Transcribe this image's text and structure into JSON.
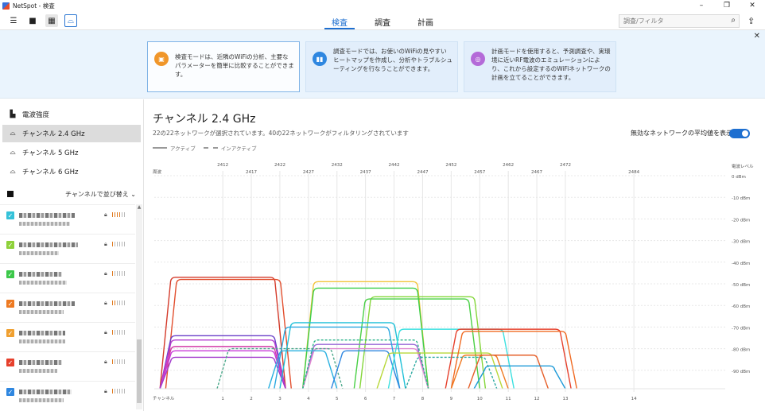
{
  "window": {
    "title": "NetSpot - 検査",
    "minimize": "–",
    "restore": "❐",
    "close": "✕"
  },
  "toolbar": {
    "tabs": [
      {
        "label": "検査",
        "active": true
      },
      {
        "label": "調査",
        "active": false
      },
      {
        "label": "計画",
        "active": false
      }
    ],
    "search_placeholder": "調査/フィルタ",
    "menu_icon": "☰",
    "stop_icon": "■",
    "grid_icon": "▦",
    "channel_icon": "⌓"
  },
  "banner": {
    "cards": [
      {
        "text": "検査モードは、近隣のWiFiの分析、主要なパラメーターを簡単に比較することができます。",
        "color": "#f0962a",
        "icon": "▣"
      },
      {
        "text": "調査モードでは、お使いのWiFiの見やすいヒートマップを作成し、分析やトラブルシューティングを行なうことができます。",
        "color": "#2f87e0",
        "icon": "▮▮"
      },
      {
        "text": "計画モードを使用すると、予測調査や、実環境に近いRF電波のエミュレーションにより、これから設定するのWiFiネットワークの計画を立てることができます。",
        "color": "#b46ad8",
        "icon": "◎"
      }
    ],
    "close": "✕"
  },
  "sidebar": {
    "items": [
      {
        "label": "電波強度",
        "icon": "▙",
        "active": false
      },
      {
        "label": "チャンネル 2.4 GHz",
        "icon": "⌓",
        "active": true
      },
      {
        "label": "チャンネル 5 GHz",
        "icon": "⌓",
        "active": false
      },
      {
        "label": "チャンネル 6 GHz",
        "icon": "⌓",
        "active": false
      }
    ],
    "sort_label": "チャンネルで並び替え ⌄",
    "networks": [
      {
        "checkbox_color": "#35c2d9",
        "signal": 0.6
      },
      {
        "checkbox_color": "#8ed13a",
        "signal": 0.2
      },
      {
        "checkbox_color": "#3cc84a",
        "signal": 0.2
      },
      {
        "checkbox_color": "#ee7a22",
        "signal": 0.4
      },
      {
        "checkbox_color": "#f0a030",
        "signal": 0.2
      },
      {
        "checkbox_color": "#e6402c",
        "signal": 0.2
      },
      {
        "checkbox_color": "#2f87e0",
        "signal": 0.2
      }
    ]
  },
  "main": {
    "title": "チャンネル 2.4 GHz",
    "subtitle": "22の22ネットワークが選択されています。40の22ネットワークがフィルタリングされています",
    "legend_active": "アクティブ",
    "legend_inactive": "インアクティブ",
    "toggle_label": "無効なネットワークの平均値を表示",
    "toggle_on": true
  },
  "chart_data": {
    "type": "area",
    "xlabel_top": "周波",
    "xlabel_bottom": "チャンネル",
    "ylabel": "電波レベル",
    "freq_ticks_upper": [
      2412,
      2422,
      2432,
      2442,
      2452,
      2462,
      2472
    ],
    "freq_ticks_lower": [
      2417,
      2427,
      2437,
      2447,
      2457,
      2467,
      2484
    ],
    "channels": [
      "1",
      "2",
      "3",
      "4",
      "5",
      "6",
      "7",
      "8",
      "9",
      "10",
      "11",
      "12",
      "13",
      "14"
    ],
    "y_ticks": [
      "0 dBm",
      "-10 dBm",
      "-20 dBm",
      "-30 dBm",
      "-40 dBm",
      "-50 dBm",
      "-60 dBm",
      "-70 dBm",
      "-80 dBm",
      "-90 dBm"
    ],
    "ylim": [
      -100,
      0
    ],
    "xlim": [
      2400,
      2500
    ],
    "series": [
      {
        "center": 2412,
        "width": 22,
        "level": -47,
        "color": "#d43a2a",
        "dashed": false
      },
      {
        "center": 2413,
        "width": 22,
        "level": -48,
        "color": "#e24f2e",
        "dashed": false
      },
      {
        "center": 2437,
        "width": 22,
        "level": -49,
        "color": "#f2c43a",
        "dashed": false
      },
      {
        "center": 2437,
        "width": 22,
        "level": -52,
        "color": "#3ccf4a",
        "dashed": false
      },
      {
        "center": 2447,
        "width": 22,
        "level": -56,
        "color": "#84d63a",
        "dashed": false
      },
      {
        "center": 2446,
        "width": 22,
        "level": -57,
        "color": "#4ad046",
        "dashed": false
      },
      {
        "center": 2412,
        "width": 22,
        "level": -74,
        "color": "#6a3fc8",
        "dashed": false
      },
      {
        "center": 2412,
        "width": 22,
        "level": -76,
        "color": "#b43ad0",
        "dashed": false
      },
      {
        "center": 2412,
        "width": 22,
        "level": -79,
        "color": "#d23aa8",
        "dashed": false
      },
      {
        "center": 2412,
        "width": 22,
        "level": -81,
        "color": "#c83ad8",
        "dashed": false
      },
      {
        "center": 2412,
        "width": 22,
        "level": -84,
        "color": "#a23acc",
        "dashed": false
      },
      {
        "center": 2437,
        "width": 22,
        "level": -78,
        "color": "#9a6ad8",
        "dashed": false
      },
      {
        "center": 2437,
        "width": 22,
        "level": -80,
        "color": "#e08ad0",
        "dashed": false
      },
      {
        "center": 2437,
        "width": 22,
        "level": -76,
        "color": "#2bb38a",
        "dashed": true
      },
      {
        "center": 2422,
        "width": 22,
        "level": -80,
        "color": "#4aa88a",
        "dashed": true
      },
      {
        "center": 2433,
        "width": 22,
        "level": -68,
        "color": "#1ec0d8",
        "dashed": false
      },
      {
        "center": 2432,
        "width": 22,
        "level": -70,
        "color": "#2aa8e0",
        "dashed": false
      },
      {
        "center": 2426,
        "width": 12,
        "level": -81,
        "color": "#28b0e0",
        "dashed": false
      },
      {
        "center": 2437,
        "width": 12,
        "level": -81,
        "color": "#2f87e0",
        "dashed": false
      },
      {
        "center": 2452,
        "width": 22,
        "level": -71,
        "color": "#3ae0e0",
        "dashed": false
      },
      {
        "center": 2450,
        "width": 22,
        "level": -82,
        "color": "#b8d83a",
        "dashed": false
      },
      {
        "center": 2462,
        "width": 22,
        "level": -71,
        "color": "#e6402c",
        "dashed": false
      },
      {
        "center": 2463,
        "width": 22,
        "level": -72,
        "color": "#f06a22",
        "dashed": false
      },
      {
        "center": 2457,
        "width": 10,
        "level": -83,
        "color": "#f07a22",
        "dashed": false
      },
      {
        "center": 2462,
        "width": 14,
        "level": -83,
        "color": "#e6602a",
        "dashed": false
      },
      {
        "center": 2464,
        "width": 16,
        "level": -88,
        "color": "#1e9ad8",
        "dashed": false
      },
      {
        "center": 2452,
        "width": 16,
        "level": -84,
        "color": "#2aa8a0",
        "dashed": true
      }
    ]
  }
}
